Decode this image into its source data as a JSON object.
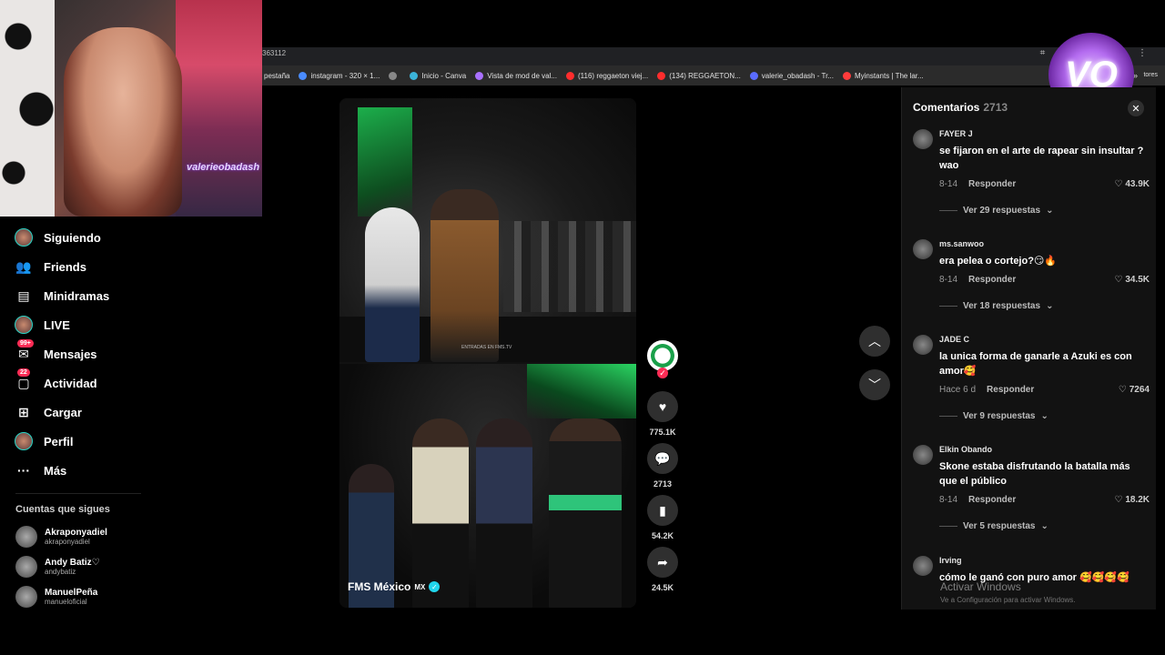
{
  "browser": {
    "url_fragment": "363112",
    "bookmarks": [
      {
        "label": "pestaña",
        "color": ""
      },
      {
        "label": "instagram - 320 × 1...",
        "color": "#4a8cff"
      },
      {
        "label": "",
        "color": "#888888"
      },
      {
        "label": "Inicio - Canva",
        "color": "#3bb4d9"
      },
      {
        "label": "Vista de mod de val...",
        "color": "#a970ff"
      },
      {
        "label": "(116) reggaeton viej...",
        "color": "#ff2d2d"
      },
      {
        "label": "(134) REGGAETON...",
        "color": "#ff2d2d"
      },
      {
        "label": "valerie_obadash - Tr...",
        "color": "#5a6cff"
      },
      {
        "label": "Myinstants | The lar...",
        "color": "#ff3b3b"
      }
    ],
    "more_label": "»",
    "right_label": "tores"
  },
  "webcam": {
    "overlay_text": "valerieobadash"
  },
  "badge": {
    "text": "VO"
  },
  "nav": {
    "items": [
      {
        "label": "Siguiendo",
        "icon": "following-avatar-icon"
      },
      {
        "label": "Friends",
        "icon": "friends-icon"
      },
      {
        "label": "Minidramas",
        "icon": "film-icon"
      },
      {
        "label": "LIVE",
        "icon": "live-avatar-icon"
      },
      {
        "label": "Mensajes",
        "icon": "messages-icon",
        "badge": "99+"
      },
      {
        "label": "Actividad",
        "icon": "activity-icon",
        "badge": "22"
      },
      {
        "label": "Cargar",
        "icon": "upload-icon"
      },
      {
        "label": "Perfil",
        "icon": "profile-icon"
      },
      {
        "label": "Más",
        "icon": "more-icon"
      }
    ],
    "following_label": "Cuentas que sigues",
    "following": [
      {
        "name": "Akraponyadiel",
        "handle": "akraponyadiel"
      },
      {
        "name": "Andy Batiz♡",
        "handle": "andybatiz"
      },
      {
        "name": "ManuelPeña",
        "handle": "manueloficial"
      }
    ]
  },
  "video": {
    "watermark": "ENTRADAS EN FMS.TV",
    "author": "FMS México",
    "author_suffix": "MX"
  },
  "actions": {
    "likes": "775.1K",
    "comments": "2713",
    "saves": "54.2K",
    "shares": "24.5K"
  },
  "comments_panel": {
    "title": "Comentarios",
    "count": "2713",
    "reply_label": "Responder",
    "items": [
      {
        "user": "FAYER J",
        "text": "se fijaron en el arte de rapear sin insultar ? wao",
        "date": "8-14",
        "likes": "43.9K",
        "replies": "Ver 29 respuestas"
      },
      {
        "user": "ms.sanwoo",
        "text": "era pelea o cortejo?😏🔥",
        "date": "8-14",
        "likes": "34.5K",
        "replies": "Ver 18 respuestas"
      },
      {
        "user": "JADE C",
        "text": "la unica forma de ganarle a Azuki es con amor🥰",
        "date": "Hace 6 d",
        "likes": "7264",
        "replies": "Ver 9 respuestas"
      },
      {
        "user": "Elkin Obando",
        "text": "Skone estaba disfrutando la batalla más que el público",
        "date": "8-14",
        "likes": "18.2K",
        "replies": "Ver 5 respuestas"
      },
      {
        "user": "Irving",
        "text": "cómo le ganó con puro amor 🥰🥰🥰🥰",
        "date": "",
        "likes": "",
        "replies": ""
      }
    ]
  },
  "windows_watermark": {
    "title": "Activar Windows",
    "subtitle": "Ve a Configuración para activar Windows."
  }
}
